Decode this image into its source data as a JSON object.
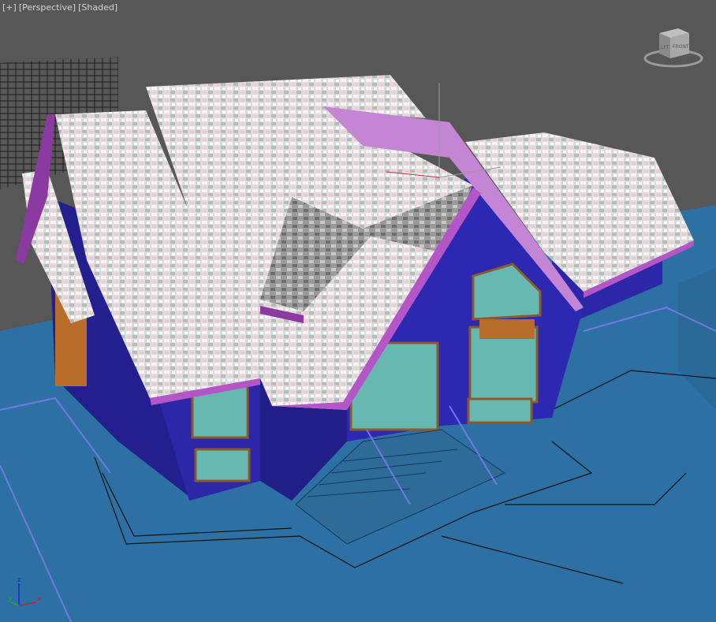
{
  "viewport": {
    "menu_label": "[+]",
    "view_label": "[Perspective]",
    "shading_label": "[Shaded]"
  },
  "viewcube": {
    "left_face": "LFT",
    "front_face": "FRONT"
  },
  "axis_gizmo": {
    "x": "x",
    "y": "y",
    "z": "z"
  },
  "colors": {
    "background": "#575757",
    "ground": "#2d70a3",
    "walls": "#2b27a8",
    "roof": "#e2e2e2",
    "trim": "#b455c8",
    "glass": "#67b8b0",
    "frames": "#8a5a2a"
  }
}
